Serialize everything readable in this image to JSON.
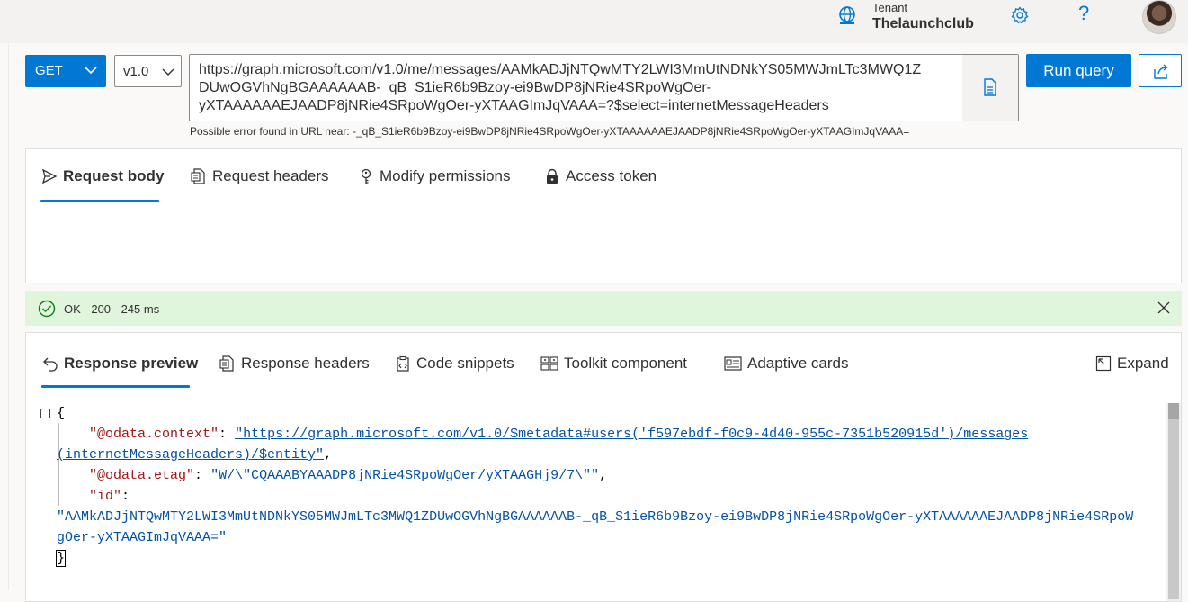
{
  "header": {
    "tenant_label": "Tenant",
    "tenant_name": "Thelaunchclub",
    "help_glyph": "?"
  },
  "query": {
    "method": "GET",
    "version": "v1.0",
    "url": "https://graph.microsoft.com/v1.0/me/messages/AAMkADJjNTQwMTY2LWI3MmUtNDNkYS05MWJmLTc3MWQ1ZDUwOGVhNgBGAAAAAAB-_qB_S1ieR6b9Bzoy-ei9BwDP8jNRie4SRpoWgOer-yXTAAAAAAEJAADP8jNRie4SRpoWgOer-yXTAAGImJqVAAA=?$select=internetMessageHeaders",
    "url_lines": [
      "https://graph.microsoft.com/v1.0/me/messages/AAMkADJjNTQwMTY2LWI3MmUtNDNkYS05MWJmLTc3MWQ1Z",
      "DUwOGVhNgBGAAAAAAB-_qB_S1ieR6b9Bzoy-ei9BwDP8jNRie4SRpoWgOer-",
      "yXTAAAAAAEJAADP8jNRie4SRpoWgOer-yXTAAGImJqVAAA=?$select=internetMessageHeaders"
    ],
    "run_label": "Run query",
    "error_text": "Possible error found in URL near: -_qB_S1ieR6b9Bzoy-ei9BwDP8jNRie4SRpoWgOer-yXTAAAAAAEJAADP8jNRie4SRpoWgOer-yXTAAGImJqVAAA="
  },
  "request_tabs": [
    {
      "label": "Request body",
      "icon": "send-icon",
      "active": true
    },
    {
      "label": "Request headers",
      "icon": "document-icon",
      "active": false
    },
    {
      "label": "Modify permissions",
      "icon": "key-icon",
      "active": false
    },
    {
      "label": "Access token",
      "icon": "lock-icon",
      "active": false
    }
  ],
  "status": {
    "text": "OK - 200 - 245 ms",
    "color": "#dff6dd"
  },
  "response_tabs": [
    {
      "label": "Response preview",
      "icon": "undo-icon",
      "active": true
    },
    {
      "label": "Response headers",
      "icon": "document-icon",
      "active": false
    },
    {
      "label": "Code snippets",
      "icon": "clipboard-code-icon",
      "active": false
    },
    {
      "label": "Toolkit component",
      "icon": "toolkit-icon",
      "active": false
    },
    {
      "label": "Adaptive cards",
      "icon": "card-icon",
      "active": false
    }
  ],
  "expand_label": "Expand",
  "json_response": {
    "open_brace": "{",
    "close_brace": "}",
    "context_key": "\"@odata.context\"",
    "context_value_line1": "\"https://graph.microsoft.com/v1.0/$metadata#users('f597ebdf-f0c9-4d40-955c-7351b520915d')/messages",
    "context_value_line2": "(internetMessageHeaders)/$entity\"",
    "etag_key": "\"@odata.etag\"",
    "etag_value": "\"W/\\\"CQAAABYAAADP8jNRie4SRpoWgOer/yXTAAGHj9/7\\\"\"",
    "id_key": "\"id\"",
    "id_value_line1": "\"AAMkADJjNTQwMTY2LWI3MmUtNDNkYS05MWJmLTc3MWQ1ZDUwOGVhNgBGAAAAAAB-_qB_S1ieR6b9Bzoy-ei9BwDP8jNRie4SRpoWgOer-yXTAAAAAAEJAADP8jNRie4SRpoW",
    "id_value_line2": "gOer-yXTAAGImJqVAAA=\""
  },
  "colors": {
    "accent": "#0078d4",
    "json_key": "#a31515",
    "json_string": "#0451a5"
  }
}
